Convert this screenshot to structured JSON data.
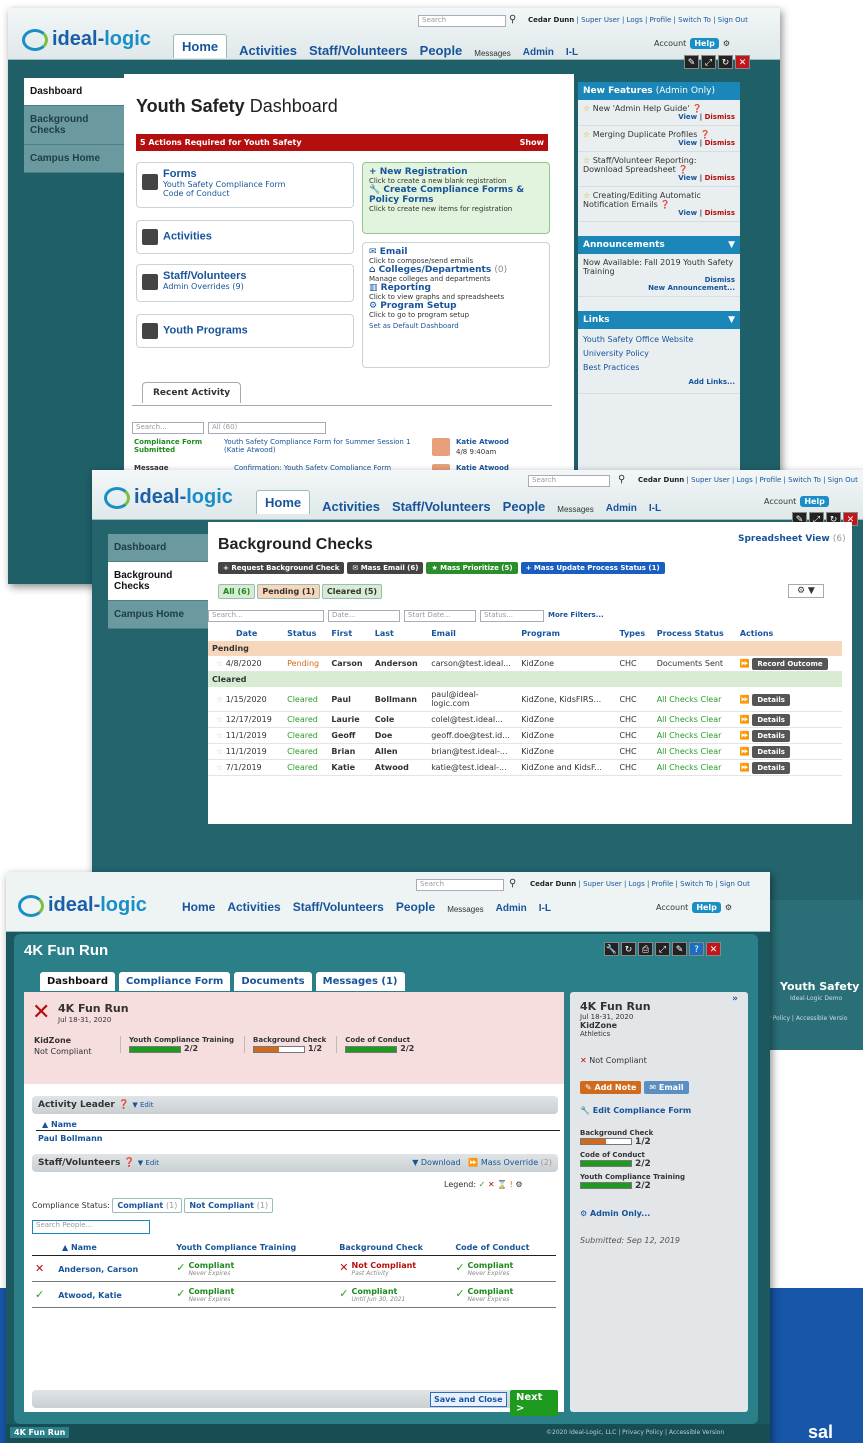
{
  "s1": {
    "search": "Search",
    "user": "Cedar Dunn",
    "user_links": "| Super User | Logs | Profile | Switch To | Sign Out",
    "nav": [
      "Home",
      "Activities",
      "Staff/Volunteers",
      "People",
      "Messages",
      "Admin",
      "I-L"
    ],
    "account": "Account",
    "help": "Help",
    "sidebar": [
      "Dashboard",
      "Background Checks",
      "Campus Home"
    ],
    "title_bold": "Youth Safety",
    "title_rest": " Dashboard",
    "alert": "5 Actions Required for Youth Safety",
    "alert_btn": "Show",
    "forms_title": "Forms",
    "forms_l1": "Youth Safety Compliance Form",
    "forms_l2": "Code of Conduct",
    "activities": "Activities",
    "staff": "Staff/Volunteers",
    "staff_sub": "Admin Overrides",
    "staff_count": "(9)",
    "youth": "Youth Programs",
    "newreg": "New Registration",
    "newreg_sub": "Click to create a new blank registration",
    "createforms": "Create Compliance Forms & Policy Forms",
    "createforms_sub": "Click to create new items for registration",
    "email": "Email",
    "email_sub": "Click to compose/send emails",
    "colleges": "Colleges/Departments",
    "colleges_count": "(0)",
    "colleges_sub": "Manage colleges and departments",
    "reporting": "Reporting",
    "reporting_sub": "Click to view graphs and spreadsheets",
    "setup": "Program Setup",
    "setup_sub": "Click to go to program setup",
    "default": "Set as Default Dashboard",
    "recent": "Recent Activity",
    "r_search": "Search...",
    "r_all": "All (60)",
    "r1_type": "Compliance Form Submitted",
    "r1_desc": "Youth Safety Compliance Form for Summer Session 1 (Katie Atwood)",
    "r1_name": "Katie Atwood",
    "r1_time": "4/8 9:40am",
    "r2_type": "Message",
    "r2_desc": "Confirmation: Youth Safety Compliance Form",
    "r2_name": "Katie Atwood",
    "newfeat": "New Features",
    "newfeat_sub": "(Admin Only)",
    "feats": [
      {
        "t": "New 'Admin Help Guide'"
      },
      {
        "t": "Merging Duplicate Profiles"
      },
      {
        "t": "Staff/Volunteer Reporting: Download Spreadsheet"
      },
      {
        "t": "Creating/Editing Automatic Notification Emails"
      }
    ],
    "view": "View",
    "dismiss": "Dismiss",
    "announce": "Announcements",
    "ann_text": "Now Available: Fall 2019 Youth Safety Training",
    "ann_dismiss": "Dismiss",
    "ann_new": "New Announcement...",
    "links": "Links",
    "link_items": [
      "Youth Safety Office Website",
      "University Policy",
      "Best Practices"
    ],
    "add_links": "Add Links..."
  },
  "s2": {
    "search": "Search",
    "user": "Cedar Dunn",
    "user_links": "| Super User | Logs | Profile | Switch To | Sign Out",
    "nav": [
      "Home",
      "Activities",
      "Staff/Volunteers",
      "People",
      "Messages",
      "Admin",
      "I-L"
    ],
    "account": "Account",
    "help": "Help",
    "sidebar": [
      "Dashboard",
      "Background Checks",
      "Campus Home"
    ],
    "title": "Background Checks",
    "spread": "Spreadsheet View",
    "spread_count": "(6)",
    "btns": [
      "Request Background Check",
      "Mass Email (6)",
      "Mass Prioritize (5)",
      "Mass Update Process Status (1)"
    ],
    "filters": [
      "All (6)",
      "Pending (1)",
      "Cleared (5)"
    ],
    "f_search": "Search...",
    "f_date": "Date...",
    "f_start": "Start Date...",
    "f_status": "Status...",
    "f_more": "More Filters...",
    "cols": [
      "Date",
      "Status",
      "First",
      "Last",
      "Email",
      "Program",
      "Types",
      "Process Status",
      "Actions"
    ],
    "pending_label": "Pending",
    "cleared_label": "Cleared",
    "pending": [
      {
        "date": "4/8/2020",
        "status": "Pending",
        "first": "Carson",
        "last": "Anderson",
        "email": "carson@test.ideal...",
        "program": "KidZone",
        "type": "CHC",
        "process": "Documents Sent",
        "action": "Record Outcome"
      }
    ],
    "cleared": [
      {
        "date": "1/15/2020",
        "status": "Cleared",
        "first": "Paul",
        "last": "Bollmann",
        "email": "paul@ideal-logic.com",
        "program": "KidZone, KidsFIRS...",
        "type": "CHC",
        "process": "All Checks Clear",
        "action": "Details"
      },
      {
        "date": "12/17/2019",
        "status": "Cleared",
        "first": "Laurie",
        "last": "Cole",
        "email": "colel@test.ideal...",
        "program": "KidZone",
        "type": "CHC",
        "process": "All Checks Clear",
        "action": "Details"
      },
      {
        "date": "11/1/2019",
        "status": "Cleared",
        "first": "Geoff",
        "last": "Doe",
        "email": "geoff.doe@test.id...",
        "program": "KidZone",
        "type": "CHC",
        "process": "All Checks Clear",
        "action": "Details"
      },
      {
        "date": "11/1/2019",
        "status": "Cleared",
        "first": "Brian",
        "last": "Allen",
        "email": "brian@test.ideal-...",
        "program": "KidZone",
        "type": "CHC",
        "process": "All Checks Clear",
        "action": "Details"
      },
      {
        "date": "7/1/2019",
        "status": "Cleared",
        "first": "Katie",
        "last": "Atwood",
        "email": "katie@test.ideal-...",
        "program": "KidZone and KidsF...",
        "type": "CHC",
        "process": "All Checks Clear",
        "action": "Details"
      }
    ]
  },
  "s3": {
    "search": "Search",
    "user": "Cedar Dunn",
    "user_links": "| Super User | Logs | Profile | Switch To | Sign Out",
    "nav": [
      "Home",
      "Activities",
      "Staff/Volunteers",
      "People",
      "Messages",
      "Admin",
      "I-L"
    ],
    "account": "Account",
    "help": "Help",
    "title": "4K Fun Run",
    "tabs": [
      "Dashboard",
      "Compliance Form",
      "Documents",
      "Messages (1)"
    ],
    "ev_title": "4K Fun Run",
    "ev_date": "Jul 18-31, 2020",
    "kz": "KidZone",
    "kz_status": "Not Compliant",
    "prog": [
      {
        "name": "Youth Compliance Training",
        "val": "2/2",
        "frac": 1,
        "color": "#1e9a1e"
      },
      {
        "name": "Background Check",
        "val": "1/2",
        "frac": 0.5,
        "color": "#d06a1c"
      },
      {
        "name": "Code of Conduct",
        "val": "2/2",
        "frac": 1,
        "color": "#1e9a1e"
      }
    ],
    "leader_label": "Activity Leader",
    "edit": "Edit",
    "name_col": "Name",
    "leader": "Paul Bollmann",
    "staff_label": "Staff/Volunteers",
    "download": "Download",
    "override": "Mass Override",
    "override_count": "(2)",
    "legend": "Legend:",
    "comp_status": "Compliance Status:",
    "compliant_btn": "Compliant",
    "compliant_count": "(1)",
    "noncompliant_btn": "Not Compliant",
    "noncompliant_count": "(1)",
    "search_people": "Search People...",
    "tcols": [
      "Name",
      "Youth Compliance Training",
      "Background Check",
      "Code of Conduct"
    ],
    "rows": [
      {
        "name": "Anderson, Carson",
        "ok": false,
        "c1": "Compliant",
        "c1s": "Never Expires",
        "c1ok": true,
        "c2": "Not Compliant",
        "c2s": "Past Activity",
        "c2ok": false,
        "c3": "Compliant",
        "c3s": "Never Expires",
        "c3ok": true
      },
      {
        "name": "Atwood, Katie",
        "ok": true,
        "c1": "Compliant",
        "c1s": "Never Expires",
        "c1ok": true,
        "c2": "Compliant",
        "c2s": "Until Jun 30, 2021",
        "c2ok": true,
        "c3": "Compliant",
        "c3s": "Never Expires",
        "c3ok": true
      }
    ],
    "save": "Save and Close",
    "next": "Next >",
    "side_title": "4K Fun Run",
    "side_date": "Jul 18-31, 2020",
    "side_kz": "KidZone",
    "side_cat": "Athletics",
    "side_status": "Not Compliant",
    "add_note": "Add Note",
    "email": "Email",
    "edit_form": "Edit Compliance Form",
    "side_prog": [
      {
        "name": "Background Check",
        "val": "1/2",
        "frac": 0.5,
        "color": "#d06a1c"
      },
      {
        "name": "Code of Conduct",
        "val": "2/2",
        "frac": 1,
        "color": "#1e9a1e"
      },
      {
        "name": "Youth Compliance Training",
        "val": "2/2",
        "frac": 1,
        "color": "#1e9a1e"
      }
    ],
    "admin_only": "Admin Only...",
    "submitted": "Submitted: Sep 12, 2019",
    "bottom_tab": "4K Fun Run",
    "footer": "©2020 Ideal-Logic, LLC | Privacy Policy | Accessible Version",
    "bg_title": "Youth Safety",
    "bg_sub": "Ideal-Logic Demo",
    "bg_links": "cy Policy | Accessible Versio",
    "bg_demo": "Ideal-Logic Demo",
    "sal": "sal"
  }
}
